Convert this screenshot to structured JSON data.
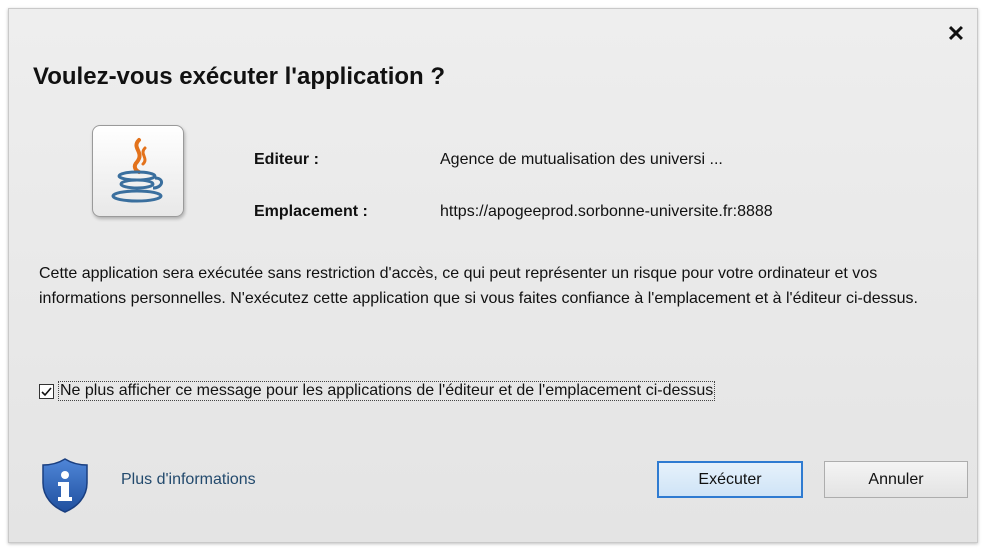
{
  "dialog": {
    "title": "Voulez-vous exécuter l'application ?",
    "close_icon": "close-icon",
    "app_icon": "java-icon",
    "publisher_label": "Editeur :",
    "publisher_value": "Agence de mutualisation des universi ...",
    "location_label": "Emplacement :",
    "location_value": "https://apogeeprod.sorbonne-universite.fr:8888",
    "message": "Cette application sera exécutée sans restriction d'accès, ce qui peut représenter un risque pour votre ordinateur et vos informations personnelles. N'exécutez cette application que si vous faites confiance à l'emplacement et à l'éditeur ci-dessus.",
    "checkbox": {
      "label": "Ne plus afficher ce message pour les applications de l'éditeur et de l'emplacement ci-dessus",
      "checked": true
    },
    "info_icon": "shield-info-icon",
    "more_info_link": "Plus d'informations",
    "run_button": "Exécuter",
    "cancel_button": "Annuler"
  },
  "colors": {
    "accent": "#2f7bd1",
    "link": "#234a6d",
    "shield": "#2a5fb8",
    "java_orange": "#e3721b",
    "java_blue": "#3a6f9e"
  }
}
